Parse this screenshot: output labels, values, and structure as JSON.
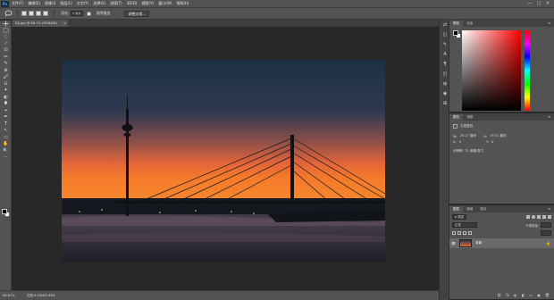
{
  "menubar": {
    "logo": "Ps",
    "items": [
      "文件(F)",
      "编辑(E)",
      "图像(I)",
      "图层(L)",
      "文字(Y)",
      "选择(S)",
      "滤镜(T)",
      "3D(D)",
      "视图(V)",
      "窗口(W)",
      "帮助(H)"
    ],
    "window_controls": [
      "—",
      "□",
      "✕"
    ]
  },
  "options_bar": {
    "feather_label": "羽化:",
    "feather_value": "0 像素",
    "antialias_label": "消除锯齿",
    "refine_button": "调整边缘..."
  },
  "tools": [
    "⬚",
    "▭",
    "◌",
    "⟋",
    "⊡",
    "✂",
    "✎",
    "⊕",
    "🖌",
    "⎌",
    "✦",
    "◐",
    "⬮",
    "⌖",
    "✒",
    "T",
    "↖",
    "▭",
    "✋",
    "🔍",
    "⋯"
  ],
  "document": {
    "tab_title": "DJI.jpg @ 66.7% (RGB/8#)",
    "tab_close": "×"
  },
  "statusbar": {
    "zoom": "66.67%",
    "doc_info": "文档:5.93M/5.93M"
  },
  "icon_strip": [
    "⇄",
    "◱",
    "✎",
    "A",
    "¶",
    "◰",
    "◍",
    "◉",
    "⊞"
  ],
  "panels": {
    "color": {
      "tabs": [
        "颜色",
        "色板"
      ],
      "menu": "≡",
      "hue_colors": [
        "#ff0000",
        "#ffff00",
        "#00ff00",
        "#00ffff",
        "#0000ff",
        "#ff00ff",
        "#ff0000"
      ],
      "picker_base": "#ff0000"
    },
    "properties": {
      "tabs": [
        "属性",
        "调整"
      ],
      "menu": "≡",
      "title": "文档属性",
      "w_label": "W:",
      "w_value": "29.27 厘米",
      "h_label": "H:",
      "h_value": "19.51 厘米",
      "x_label": "X:",
      "x_value": "0",
      "y_label": "Y:",
      "y_value": "0",
      "resolution": "分辨率: 72 像素/英寸"
    },
    "layers": {
      "tabs": [
        "图层",
        "通道",
        "路径"
      ],
      "menu": "≡",
      "kind_label": "ρ 类型",
      "blend_mode": "正常",
      "opacity_label": "不透明度:",
      "layer_name": "背景",
      "lock_icon": "🔒",
      "eye_icon": "👁",
      "footer_icons": [
        "⛓",
        "fx",
        "◐",
        "◧",
        "▭",
        "▣",
        "🗑"
      ]
    }
  }
}
